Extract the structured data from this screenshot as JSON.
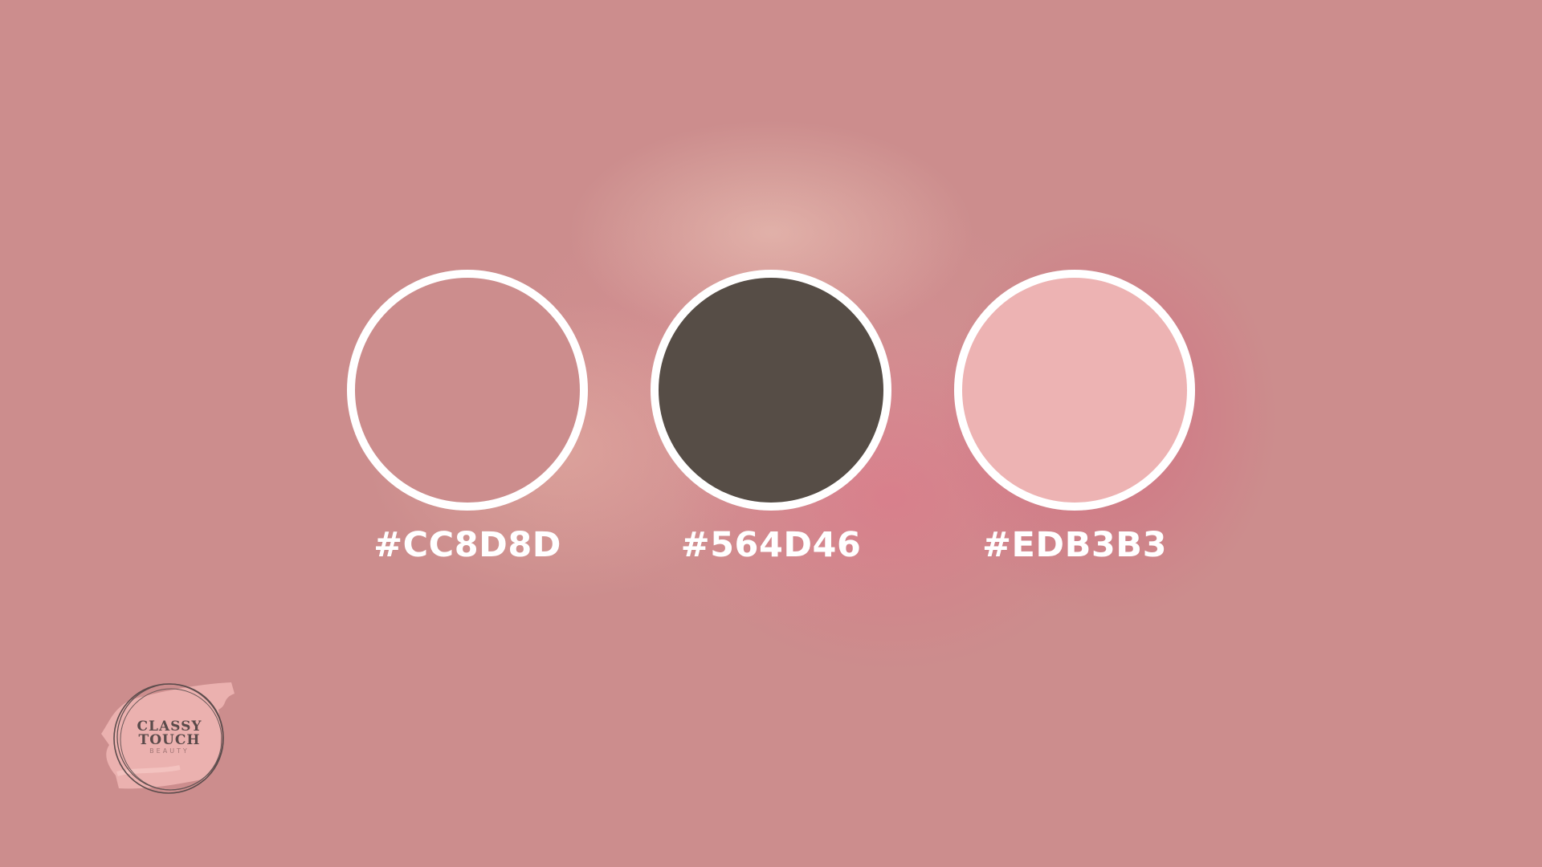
{
  "background_color": "#CC8D8D",
  "swatches": [
    {
      "code": "#CC8D8D",
      "color": "#CC8D8D"
    },
    {
      "code": "#564D46",
      "color": "#564D46"
    },
    {
      "code": "#EDB3B3",
      "color": "#EDB3B3"
    }
  ],
  "logo": {
    "line1": "CLASSY",
    "line2": "TOUCH",
    "line3": "BEAUTY"
  }
}
